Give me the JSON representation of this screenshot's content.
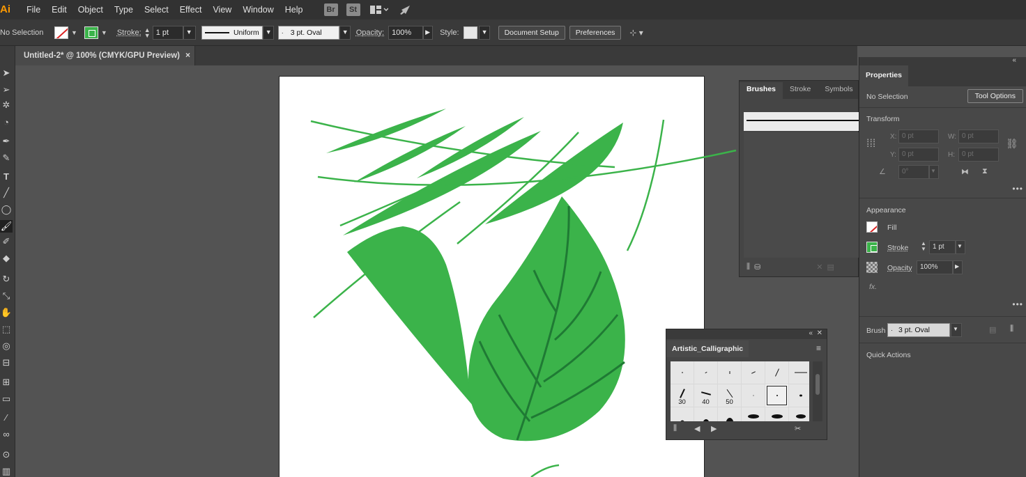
{
  "menubar": {
    "app_logo": "Ai",
    "items": [
      "File",
      "Edit",
      "Object",
      "Type",
      "Select",
      "Effect",
      "View",
      "Window",
      "Help"
    ],
    "bridge_label": "Br",
    "stock_label": "St"
  },
  "control_bar": {
    "selection_label": "No Selection",
    "stroke_label": "Stroke:",
    "stroke_weight": "1 pt",
    "profile_label": "Uniform",
    "brush_label": "3 pt. Oval",
    "opacity_label": "Opacity:",
    "opacity_value": "100%",
    "style_label": "Style:",
    "document_setup_button": "Document Setup",
    "preferences_button": "Preferences"
  },
  "document_tab": {
    "title": "Untitled-2* @ 100% (CMYK/GPU Preview)",
    "close": "×"
  },
  "brushes_panel": {
    "tabs": [
      "Brushes",
      "Stroke",
      "Symbols"
    ]
  },
  "artistic_panel": {
    "title": "Artistic_Calligraphic",
    "sizes": [
      "30",
      "40",
      "50"
    ]
  },
  "properties": {
    "tab": "Properties",
    "selection": "No Selection",
    "tool_options_button": "Tool Options",
    "transform_title": "Transform",
    "x_label": "X:",
    "y_label": "Y:",
    "w_label": "W:",
    "h_label": "H:",
    "x_value": "0 pt",
    "y_value": "0 pt",
    "w_value": "0 pt",
    "h_value": "0 pt",
    "angle_value": "0°",
    "appearance_title": "Appearance",
    "fill_label": "Fill",
    "stroke_label": "Stroke",
    "stroke_value": "1 pt",
    "opacity_label": "Opacity",
    "opacity_value": "100%",
    "fx_label": "fx.",
    "brush_label": "Brush",
    "brush_value": "3 pt. Oval",
    "quick_actions_title": "Quick Actions"
  },
  "colors": {
    "leaf_fill": "#3bb34a",
    "vein": "#1f7a34",
    "ui_dark": "#323232",
    "ui_panel": "#484848"
  }
}
